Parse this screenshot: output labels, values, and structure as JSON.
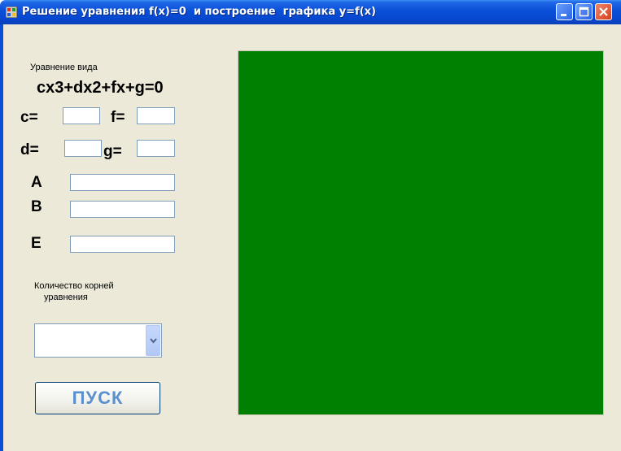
{
  "window": {
    "title": "Решение уравнения f(x)=0  и построение  графика y=f(x)",
    "colors": {
      "titlebar": "#0a4fd8",
      "client": "#ece9d8",
      "plot": "#008000",
      "button_text": "#5a8fd0"
    }
  },
  "form": {
    "equation_caption": "Уравнение вида",
    "equation": "cx3+dx2+fx+g=0",
    "c_label": "c=",
    "f_label": "f=",
    "d_label": "d=",
    "g_label": "g=",
    "a_label": "A",
    "b_label": "B",
    "e_label": "E",
    "c_value": "",
    "f_value": "",
    "d_value": "",
    "g_value": "",
    "a_value": "",
    "b_value": "",
    "e_value": "",
    "roots_caption_line1": "Количество корней",
    "roots_caption_line2": "уравнения",
    "roots_selected": "",
    "run_label": "ПУСК"
  },
  "icons": [
    "app-icon",
    "minimize-icon",
    "maximize-icon",
    "close-icon",
    "chevron-down-icon"
  ]
}
